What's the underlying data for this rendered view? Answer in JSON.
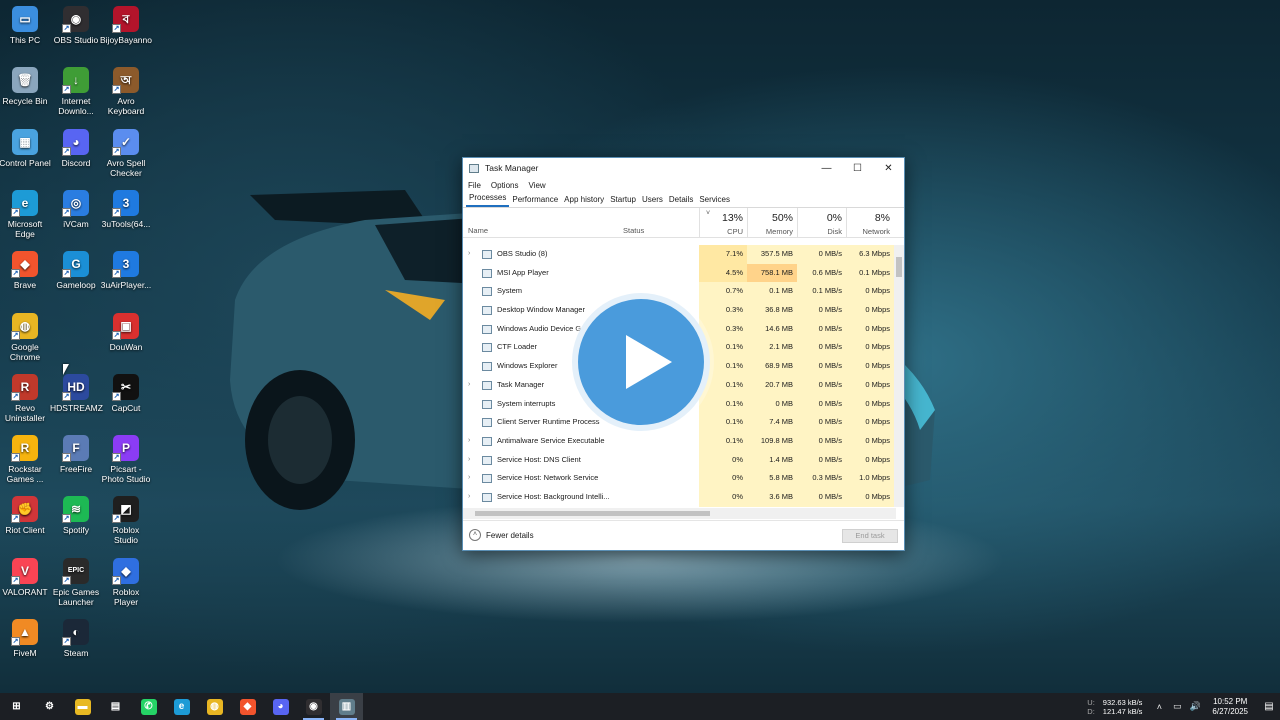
{
  "desktop": {
    "icons": [
      {
        "label": "This PC",
        "icon": "this-pc-icon",
        "color": "#3b8ede",
        "glyph": "▭",
        "shortcut": false
      },
      {
        "label": "OBS Studio",
        "icon": "obs-studio-icon",
        "color": "#302e31",
        "glyph": "◉",
        "shortcut": true
      },
      {
        "label": "BijoyBayanno",
        "icon": "bijoy-bayanno-icon",
        "color": "#b3142b",
        "glyph": "ব",
        "shortcut": true
      },
      {
        "label": "Recycle Bin",
        "icon": "recycle-bin-icon",
        "color": "#8aa6bd",
        "glyph": "🗑",
        "shortcut": false
      },
      {
        "label": "Internet Downlo...",
        "icon": "internet-download-manager-icon",
        "color": "#3f9d36",
        "glyph": "↓",
        "shortcut": true
      },
      {
        "label": "Avro Keyboard",
        "icon": "avro-keyboard-icon",
        "color": "#8c5a2b",
        "glyph": "অ",
        "shortcut": true
      },
      {
        "label": "Control Panel",
        "icon": "control-panel-icon",
        "color": "#4aa3df",
        "glyph": "▦",
        "shortcut": false
      },
      {
        "label": "Discord",
        "icon": "discord-icon",
        "color": "#5865f2",
        "glyph": "◕",
        "shortcut": true
      },
      {
        "label": "Avro Spell Checker",
        "icon": "avro-spell-checker-icon",
        "color": "#5b8def",
        "glyph": "✓",
        "shortcut": true
      },
      {
        "label": "Microsoft Edge",
        "icon": "edge-icon",
        "color": "#1d9bd6",
        "glyph": "e",
        "shortcut": true
      },
      {
        "label": "iVCam",
        "icon": "ivcam-icon",
        "color": "#2a7de1",
        "glyph": "◎",
        "shortcut": true
      },
      {
        "label": "3uTools(64...",
        "icon": "3utools-icon",
        "color": "#1f7ae0",
        "glyph": "3",
        "shortcut": true
      },
      {
        "label": "Brave",
        "icon": "brave-icon",
        "color": "#f2542d",
        "glyph": "◆",
        "shortcut": true
      },
      {
        "label": "Gameloop",
        "icon": "gameloop-icon",
        "color": "#1b8fd6",
        "glyph": "G",
        "shortcut": true
      },
      {
        "label": "3uAirPlayer...",
        "icon": "3uairplayer-icon",
        "color": "#1f7ae0",
        "glyph": "3",
        "shortcut": true
      },
      {
        "label": "Google Chrome",
        "icon": "chrome-icon",
        "color": "#e8b623",
        "glyph": "◍",
        "shortcut": true
      },
      {
        "label": "",
        "icon": "",
        "color": "",
        "glyph": "",
        "shortcut": false
      },
      {
        "label": "DouWan",
        "icon": "douwan-icon",
        "color": "#d9302f",
        "glyph": "▣",
        "shortcut": true
      },
      {
        "label": "Revo Uninstaller",
        "icon": "revo-uninstaller-icon",
        "color": "#c0392b",
        "glyph": "R",
        "shortcut": true
      },
      {
        "label": "HDSTREAMZ",
        "icon": "hdstreamz-icon",
        "color": "#2c4a9e",
        "glyph": "HD",
        "shortcut": true
      },
      {
        "label": "CapCut",
        "icon": "capcut-icon",
        "color": "#111111",
        "glyph": "✂",
        "shortcut": true
      },
      {
        "label": "Rockstar Games ...",
        "icon": "rockstar-games-icon",
        "color": "#f6b40e",
        "glyph": "R",
        "shortcut": true
      },
      {
        "label": "FreeFire",
        "icon": "freefire-icon",
        "color": "#5b7bb5",
        "glyph": "F",
        "shortcut": true
      },
      {
        "label": "Picsart - Photo Studio",
        "icon": "picsart-icon",
        "color": "#8b3cf5",
        "glyph": "P",
        "shortcut": true
      },
      {
        "label": "Riot Client",
        "icon": "riot-client-icon",
        "color": "#d13639",
        "glyph": "✊",
        "shortcut": true
      },
      {
        "label": "Spotify",
        "icon": "spotify-icon",
        "color": "#1db954",
        "glyph": "≋",
        "shortcut": true
      },
      {
        "label": "Roblox Studio",
        "icon": "roblox-studio-icon",
        "color": "#1f1f1f",
        "glyph": "◩",
        "shortcut": true
      },
      {
        "label": "VALORANT",
        "icon": "valorant-icon",
        "color": "#fa4454",
        "glyph": "V",
        "shortcut": true
      },
      {
        "label": "Epic Games Launcher",
        "icon": "epic-games-icon",
        "color": "#2a2a2a",
        "glyph": "EPIC",
        "shortcut": true
      },
      {
        "label": "Roblox Player",
        "icon": "roblox-player-icon",
        "color": "#2f6fe0",
        "glyph": "◆",
        "shortcut": true
      },
      {
        "label": "FiveM",
        "icon": "fivem-icon",
        "color": "#f08a24",
        "glyph": "▲",
        "shortcut": true
      },
      {
        "label": "Steam",
        "icon": "steam-icon",
        "color": "#1b2838",
        "glyph": "◐",
        "shortcut": true
      }
    ]
  },
  "task_manager": {
    "title": "Task Manager",
    "menu": [
      "File",
      "Options",
      "View"
    ],
    "tabs": [
      "Processes",
      "Performance",
      "App history",
      "Startup",
      "Users",
      "Details",
      "Services"
    ],
    "active_tab": "Processes",
    "header": {
      "name": "Name",
      "status": "Status",
      "cpu": {
        "pct": "13%",
        "label": "CPU"
      },
      "memory": {
        "pct": "50%",
        "label": "Memory"
      },
      "disk": {
        "pct": "0%",
        "label": "Disk"
      },
      "network": {
        "pct": "8%",
        "label": "Network"
      }
    },
    "processes": [
      {
        "name": "OBS Studio (8)",
        "expandable": true,
        "icon": "obs-icon",
        "cpu": "7.1%",
        "memory": "357.5 MB",
        "disk": "0 MB/s",
        "network": "6.3 Mbps"
      },
      {
        "name": "MSI App Player",
        "expandable": false,
        "icon": "msi-app-player-icon",
        "cpu": "4.5%",
        "memory": "758.1 MB",
        "disk": "0.6 MB/s",
        "network": "0.1 Mbps"
      },
      {
        "name": "System",
        "expandable": false,
        "icon": "system-icon",
        "cpu": "0.7%",
        "memory": "0.1 MB",
        "disk": "0.1 MB/s",
        "network": "0 Mbps"
      },
      {
        "name": "Desktop Window Manager",
        "expandable": false,
        "icon": "dwm-icon",
        "cpu": "0.3%",
        "memory": "36.8 MB",
        "disk": "0 MB/s",
        "network": "0 Mbps"
      },
      {
        "name": "Windows Audio Device Graph Isolation",
        "expandable": false,
        "icon": "audio-icon",
        "cpu": "0.3%",
        "memory": "14.6 MB",
        "disk": "0 MB/s",
        "network": "0 Mbps"
      },
      {
        "name": "CTF Loader",
        "expandable": false,
        "icon": "ctf-loader-icon",
        "cpu": "0.1%",
        "memory": "2.1 MB",
        "disk": "0 MB/s",
        "network": "0 Mbps"
      },
      {
        "name": "Windows Explorer",
        "expandable": false,
        "icon": "explorer-icon",
        "cpu": "0.1%",
        "memory": "68.9 MB",
        "disk": "0 MB/s",
        "network": "0 Mbps"
      },
      {
        "name": "Task Manager",
        "expandable": true,
        "icon": "task-manager-icon",
        "cpu": "0.1%",
        "memory": "20.7 MB",
        "disk": "0 MB/s",
        "network": "0 Mbps"
      },
      {
        "name": "System interrupts",
        "expandable": false,
        "icon": "system-interrupts-icon",
        "cpu": "0.1%",
        "memory": "0 MB",
        "disk": "0 MB/s",
        "network": "0 Mbps"
      },
      {
        "name": "Client Server Runtime Process",
        "expandable": false,
        "icon": "csrss-icon",
        "cpu": "0.1%",
        "memory": "7.4 MB",
        "disk": "0 MB/s",
        "network": "0 Mbps"
      },
      {
        "name": "Antimalware Service Executable",
        "expandable": true,
        "icon": "antimalware-icon",
        "cpu": "0.1%",
        "memory": "109.8 MB",
        "disk": "0 MB/s",
        "network": "0 Mbps"
      },
      {
        "name": "Service Host: DNS Client",
        "expandable": true,
        "icon": "service-host-icon",
        "cpu": "0%",
        "memory": "1.4 MB",
        "disk": "0 MB/s",
        "network": "0 Mbps"
      },
      {
        "name": "Service Host: Network Service",
        "expandable": true,
        "icon": "service-host-icon",
        "cpu": "0%",
        "memory": "5.8 MB",
        "disk": "0.3 MB/s",
        "network": "1.0 Mbps"
      },
      {
        "name": "Service Host: Background Intelli...",
        "expandable": true,
        "icon": "service-host-icon",
        "cpu": "0%",
        "memory": "3.6 MB",
        "disk": "0 MB/s",
        "network": "0 Mbps"
      }
    ],
    "fewer_details": "Fewer details",
    "end_task": "End task"
  },
  "taskbar": {
    "items": [
      {
        "name": "start",
        "glyph": "⊞",
        "color": "#1c1f24"
      },
      {
        "name": "settings",
        "glyph": "⚙",
        "color": "#1c1f24"
      },
      {
        "name": "file-explorer",
        "glyph": "▬",
        "color": "#e8b923"
      },
      {
        "name": "store",
        "glyph": "▤",
        "color": "#1c1f24"
      },
      {
        "name": "whatsapp",
        "glyph": "✆",
        "color": "#25d366"
      },
      {
        "name": "edge",
        "glyph": "e",
        "color": "#1d9bd6"
      },
      {
        "name": "chrome",
        "glyph": "◍",
        "color": "#e8b623"
      },
      {
        "name": "brave",
        "glyph": "◆",
        "color": "#f2542d"
      },
      {
        "name": "discord",
        "glyph": "◕",
        "color": "#5865f2"
      },
      {
        "name": "obs-studio",
        "glyph": "◉",
        "color": "#302e31"
      },
      {
        "name": "task-manager",
        "glyph": "▥",
        "color": "#607d8b"
      }
    ],
    "net_up_label": "U:",
    "net_up": "932.63 kB/s",
    "net_down_label": "D:",
    "net_down": "121.47 kB/s",
    "time": "10:52 PM",
    "date": "6/27/2025"
  },
  "colors": {
    "accent": "#1f6fbf",
    "heat_light": "#fff4c4",
    "heat_strong": "#ffd38a",
    "play_button": "#4a9bdc"
  }
}
